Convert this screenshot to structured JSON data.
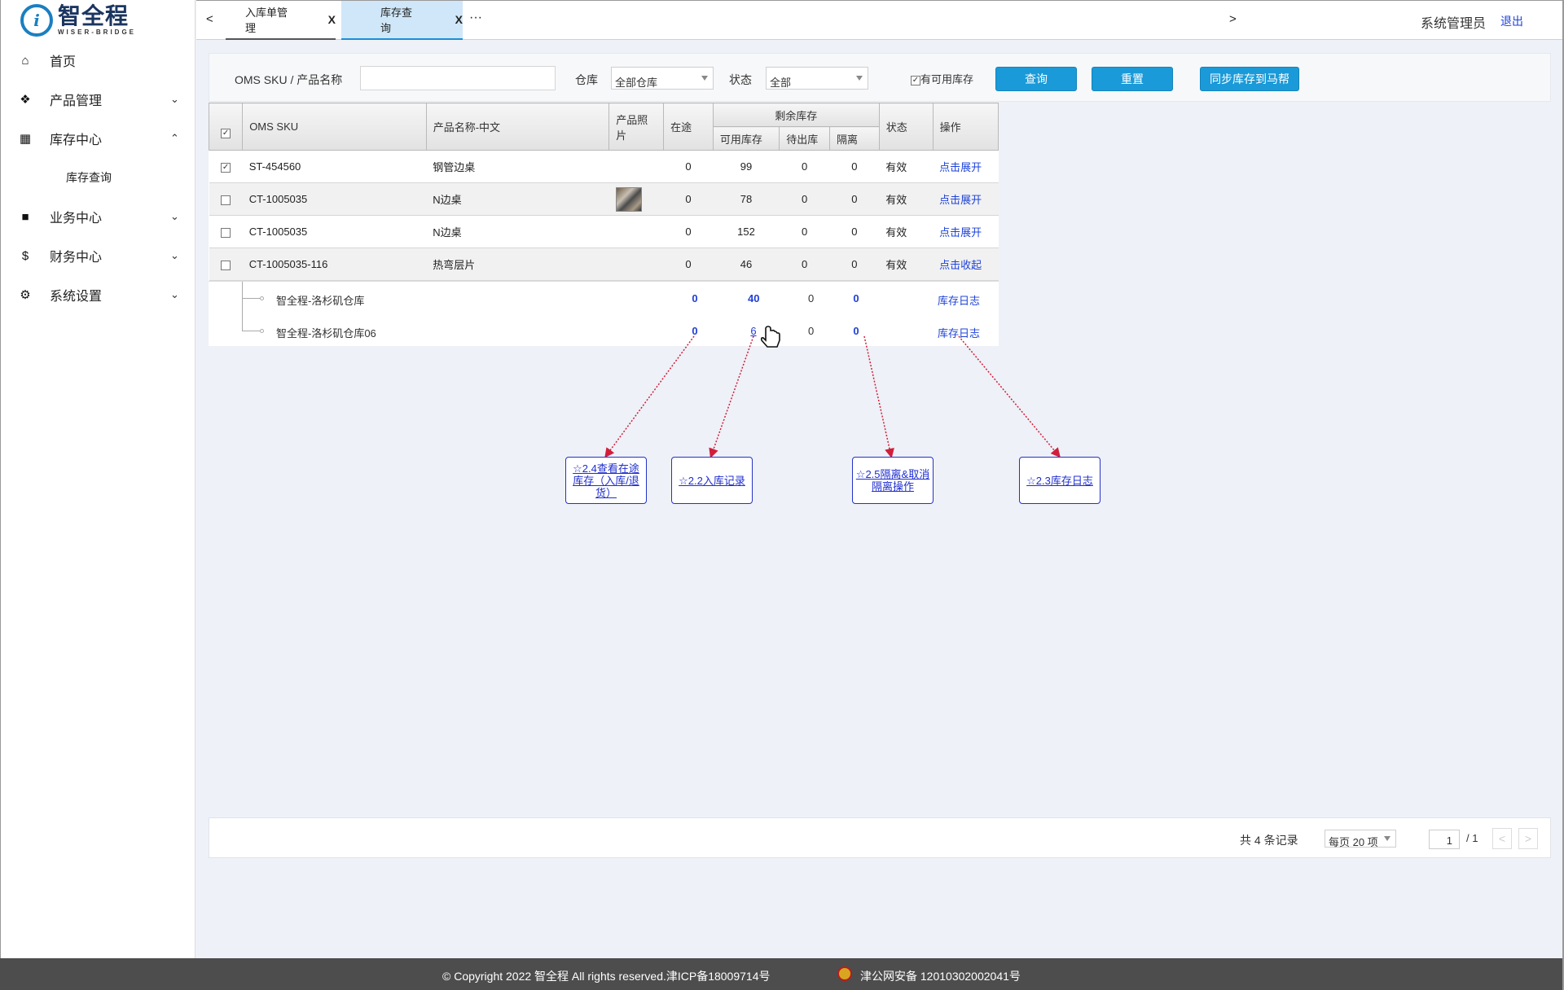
{
  "logo": {
    "cn": "智全程",
    "en": "WISER-BRIDGE"
  },
  "sidebar": {
    "items": [
      {
        "label": "首页",
        "icon": "home-icon",
        "glyph": "⌂"
      },
      {
        "label": "产品管理",
        "icon": "dropbox-icon",
        "glyph": "❖",
        "chev": "⌄"
      },
      {
        "label": "库存中心",
        "icon": "grid-icon",
        "glyph": "▦",
        "chev": "⌃"
      },
      {
        "label": "业务中心",
        "icon": "note-icon",
        "glyph": "■",
        "chev": "⌄"
      },
      {
        "label": "财务中心",
        "icon": "dollar-icon",
        "glyph": "$",
        "chev": "⌄"
      },
      {
        "label": "系统设置",
        "icon": "gear-icon",
        "glyph": "⚙",
        "chev": "⌄"
      }
    ],
    "sub": "库存查询"
  },
  "topbar": {
    "prev": "<",
    "next": ">",
    "tabs": [
      {
        "label": "入库单管理",
        "close": "X"
      },
      {
        "label": "库存查询",
        "close": "X"
      }
    ],
    "more": "···",
    "user": "系统管理员",
    "logout": "退出"
  },
  "filter": {
    "sku_label": "OMS SKU / 产品名称",
    "sku_value": "",
    "warehouse_label": "仓库",
    "warehouse_value": "全部仓库",
    "status_label": "状态",
    "status_value": "全部",
    "available_label": "有可用库存",
    "available_checked": true,
    "query": "查询",
    "reset": "重置",
    "sync": "同步库存到马帮"
  },
  "table": {
    "headers": {
      "sku": "OMS SKU",
      "name": "产品名称-中文",
      "photo": "产品照片",
      "transit": "在途",
      "remain": "剩余库存",
      "available": "可用库存",
      "pending": "待出库",
      "isolate": "隔离",
      "status": "状态",
      "action": "操作"
    },
    "rows": [
      {
        "checked": true,
        "sku": "ST-454560",
        "name": "钢管边桌",
        "transit": "0",
        "available": "99",
        "pending": "0",
        "isolate": "0",
        "status": "有效",
        "action": "点击展开"
      },
      {
        "checked": false,
        "sku": "CT-1005035",
        "name": "N边桌",
        "transit": "0",
        "available": "78",
        "pending": "0",
        "isolate": "0",
        "status": "有效",
        "action": "点击展开",
        "photo": true
      },
      {
        "checked": false,
        "sku": "CT-1005035",
        "name": "N边桌",
        "transit": "0",
        "available": "152",
        "pending": "0",
        "isolate": "0",
        "status": "有效",
        "action": "点击展开"
      },
      {
        "checked": false,
        "sku": "CT-1005035-116",
        "name": "热弯层片",
        "transit": "0",
        "available": "46",
        "pending": "0",
        "isolate": "0",
        "status": "有效",
        "action": "点击收起"
      }
    ],
    "sub": [
      {
        "warehouse": "智全程-洛杉矶仓库",
        "transit": "0",
        "available": "40",
        "pending": "0",
        "isolate": "0",
        "action": "库存日志"
      },
      {
        "warehouse": "智全程-洛杉矶仓库06",
        "transit": "0",
        "available": "6",
        "pending": "0",
        "isolate": "0",
        "action": "库存日志"
      }
    ]
  },
  "callouts": [
    "☆2.4查看在途库存（入库/退货）",
    "☆2.2入库记录",
    "☆2.5隔离&取消隔离操作",
    "☆2.3库存日志"
  ],
  "pager": {
    "total": "共 4 条记录",
    "per_page": "每页 20 项",
    "page": "1",
    "pages": "/ 1",
    "prev": "<",
    "next": ">"
  },
  "footer": {
    "copyright": "© Copyright 2022 智全程 All rights reserved.津ICP备18009714号",
    "police": "津公网安备 12010302002041号"
  },
  "colors": {
    "accent": "#1a9ad8",
    "link": "#1f43d8",
    "arrow": "#d11e3a",
    "footer": "#4d4d4d"
  }
}
